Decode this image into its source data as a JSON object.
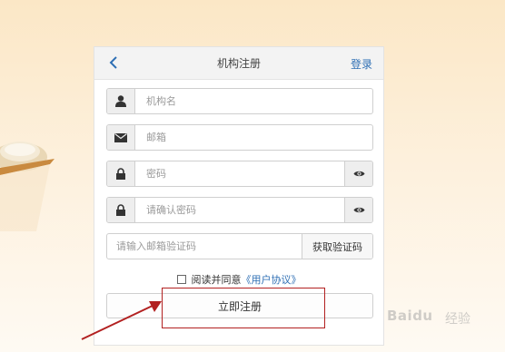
{
  "header": {
    "title": "机构注册",
    "login_label": "登录"
  },
  "form": {
    "org_name_placeholder": "机构名",
    "email_placeholder": "邮箱",
    "password_placeholder": "密码",
    "confirm_password_placeholder": "请确认密码",
    "email_code_placeholder": "请输入邮箱验证码",
    "get_code_label": "获取验证码",
    "agree_text": "阅读并同意",
    "agreement_link": "《用户协议》",
    "submit_label": "立即注册"
  },
  "icons": {
    "back": "chevron-left-icon",
    "org": "user-icon",
    "email": "envelope-icon",
    "password": "lock-icon",
    "toggle": "eye-icon"
  },
  "watermark": {
    "brand": "Baidu",
    "sub": "经验"
  },
  "colors": {
    "accent": "#2e6fb4",
    "annotation": "#b22020"
  }
}
